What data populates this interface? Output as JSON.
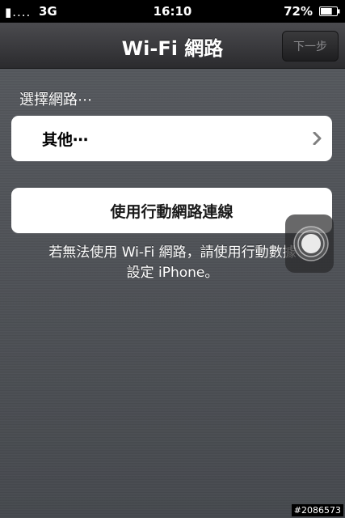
{
  "status_bar": {
    "signal": "▮....",
    "carrier": "3G",
    "time": "16:10",
    "battery_percent": "72%",
    "battery_level": 0.72
  },
  "nav": {
    "title": "Wi-Fi 網路",
    "next_label": "下一步"
  },
  "section": {
    "label": "選擇網路⋯"
  },
  "networks": {
    "other_label": "其他⋯"
  },
  "cellular": {
    "button_label": "使用行動網路連線"
  },
  "hint": {
    "line1": "若無法使用 Wi-Fi 網路，請使用行動數據",
    "line2": "設定 iPhone。"
  },
  "watermark": "#2086573",
  "icons": {
    "chevron": "chevron-right-icon",
    "assistive": "assistive-touch-icon",
    "battery": "battery-icon"
  }
}
